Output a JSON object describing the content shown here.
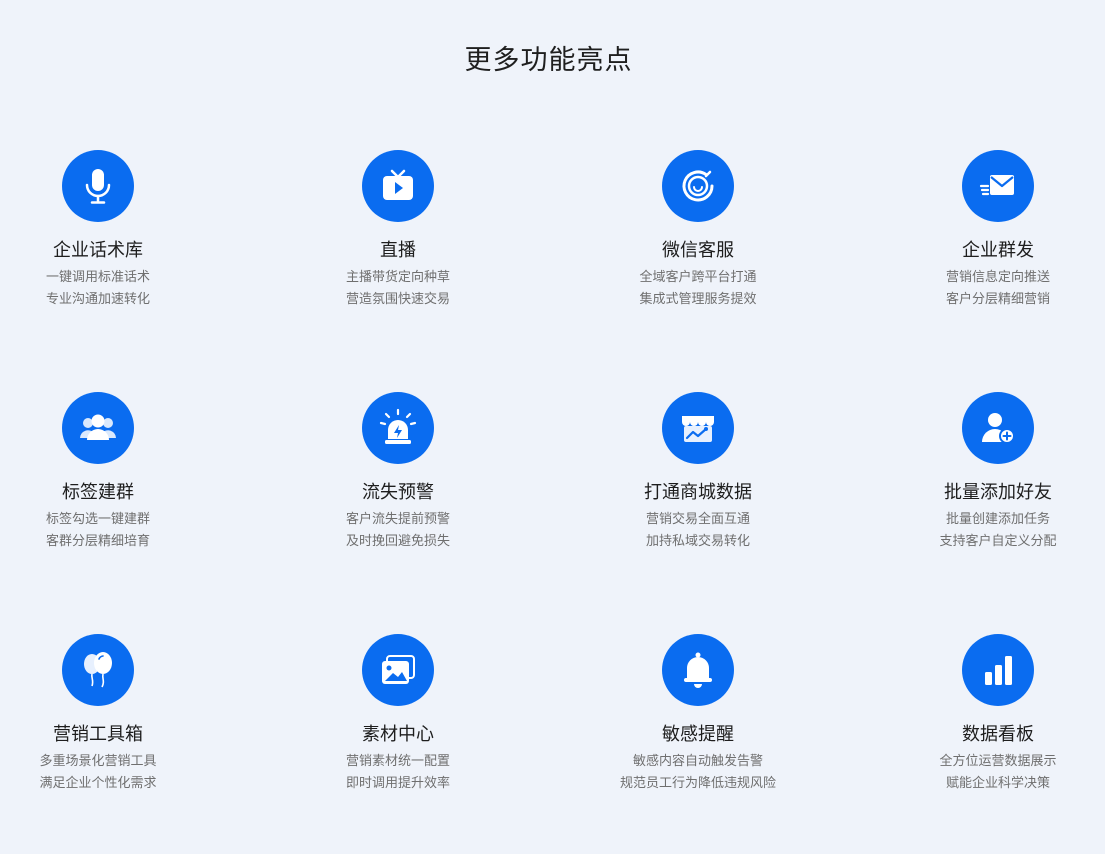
{
  "page": {
    "title": "更多功能亮点"
  },
  "features": [
    {
      "title": "企业话术库",
      "line1": "一键调用标准话术",
      "line2": "专业沟通加速转化",
      "icon": "microphone-icon"
    },
    {
      "title": "直播",
      "line1": "主播带货定向种草",
      "line2": "营造氛围快速交易",
      "icon": "tv-play-icon"
    },
    {
      "title": "微信客服",
      "line1": "全域客户跨平台打通",
      "line2": "集成式管理服务提效",
      "icon": "smile-service-icon"
    },
    {
      "title": "企业群发",
      "line1": "营销信息定向推送",
      "line2": "客户分层精细营销",
      "icon": "mail-send-icon"
    },
    {
      "title": "标签建群",
      "line1": "标签勾选一键建群",
      "line2": "客群分层精细培育",
      "icon": "group-users-icon"
    },
    {
      "title": "流失预警",
      "line1": "客户流失提前预警",
      "line2": "及时挽回避免损失",
      "icon": "alarm-light-icon"
    },
    {
      "title": "打通商城数据",
      "line1": "营销交易全面互通",
      "line2": "加持私域交易转化",
      "icon": "store-chart-icon"
    },
    {
      "title": "批量添加好友",
      "line1": "批量创建添加任务",
      "line2": "支持客户自定义分配",
      "icon": "user-add-icon"
    },
    {
      "title": "营销工具箱",
      "line1": "多重场景化营销工具",
      "line2": "满足企业个性化需求",
      "icon": "balloons-icon"
    },
    {
      "title": "素材中心",
      "line1": "营销素材统一配置",
      "line2": "即时调用提升效率",
      "icon": "image-gallery-icon"
    },
    {
      "title": "敏感提醒",
      "line1": "敏感内容自动触发告警",
      "line2": "规范员工行为降低违规风险",
      "icon": "bell-icon"
    },
    {
      "title": "数据看板",
      "line1": "全方位运营数据展示",
      "line2": "赋能企业科学决策",
      "icon": "bar-chart-icon"
    }
  ]
}
